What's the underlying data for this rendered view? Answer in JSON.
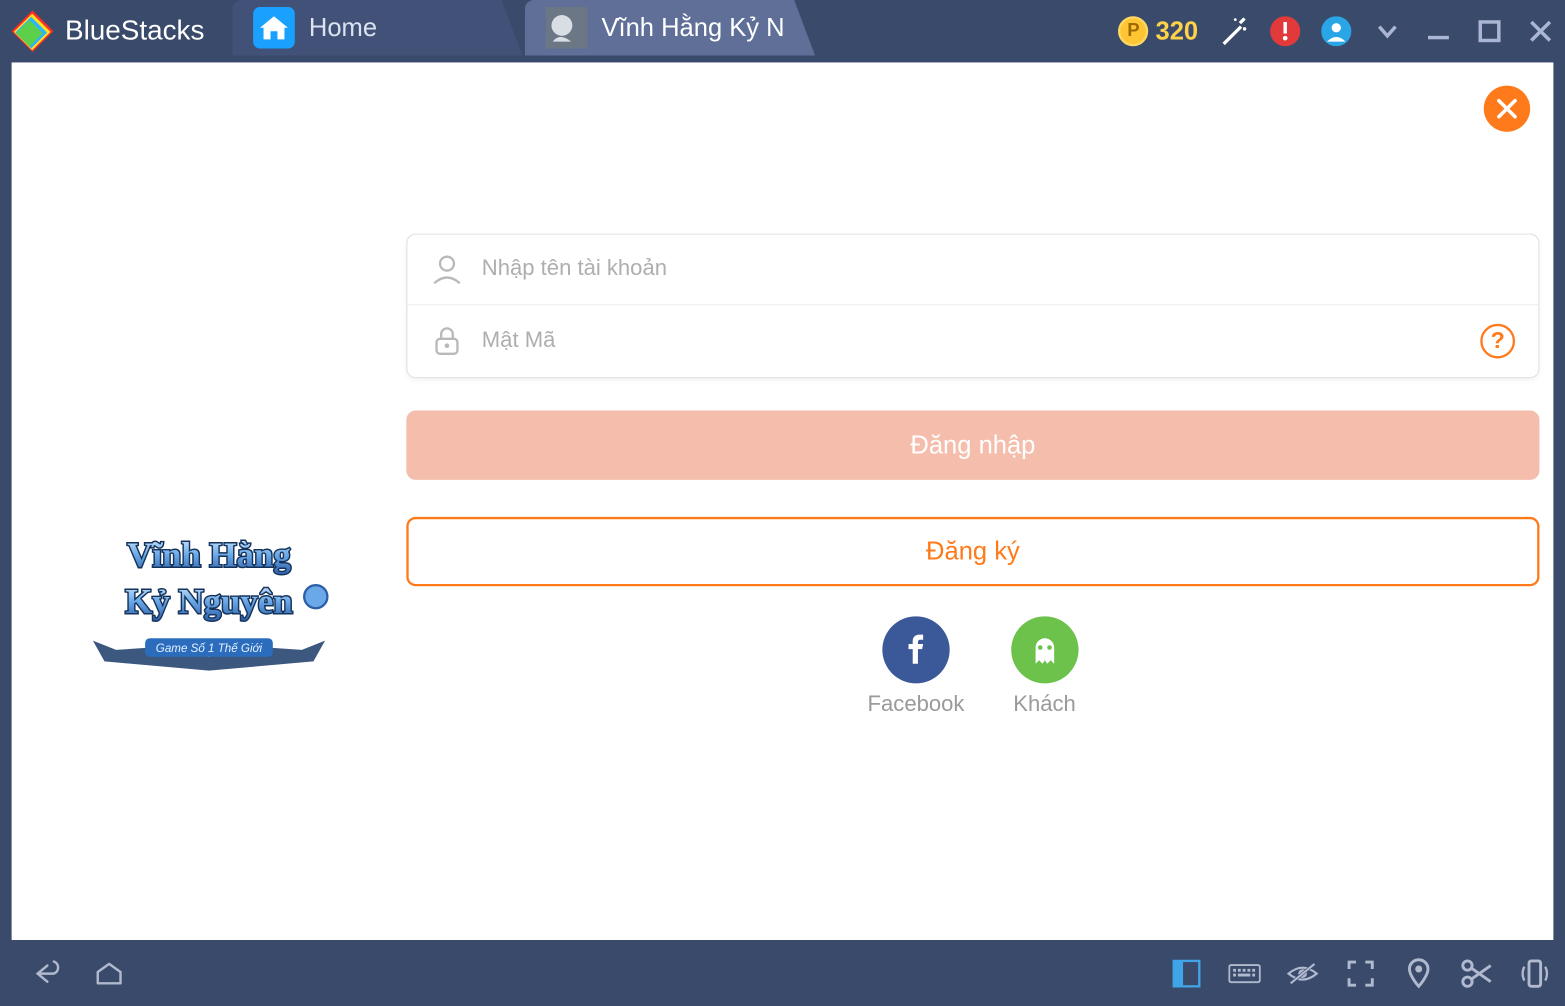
{
  "brand": "BlueStacks",
  "coins": "320",
  "tabs": [
    {
      "label": "Home"
    },
    {
      "label": "Vĩnh Hằng Kỷ N"
    }
  ],
  "login": {
    "username_placeholder": "Nhập tên tài khoản",
    "password_placeholder": "Mật Mã",
    "login_btn": "Đăng nhập",
    "register_btn": "Đăng ký",
    "facebook_label": "Facebook",
    "guest_label": "Khách"
  },
  "game_title_line1": "Vĩnh Hằng",
  "game_title_line2": "Kỷ Nguyên",
  "game_tagline": "Game Số 1 Thế Giới"
}
